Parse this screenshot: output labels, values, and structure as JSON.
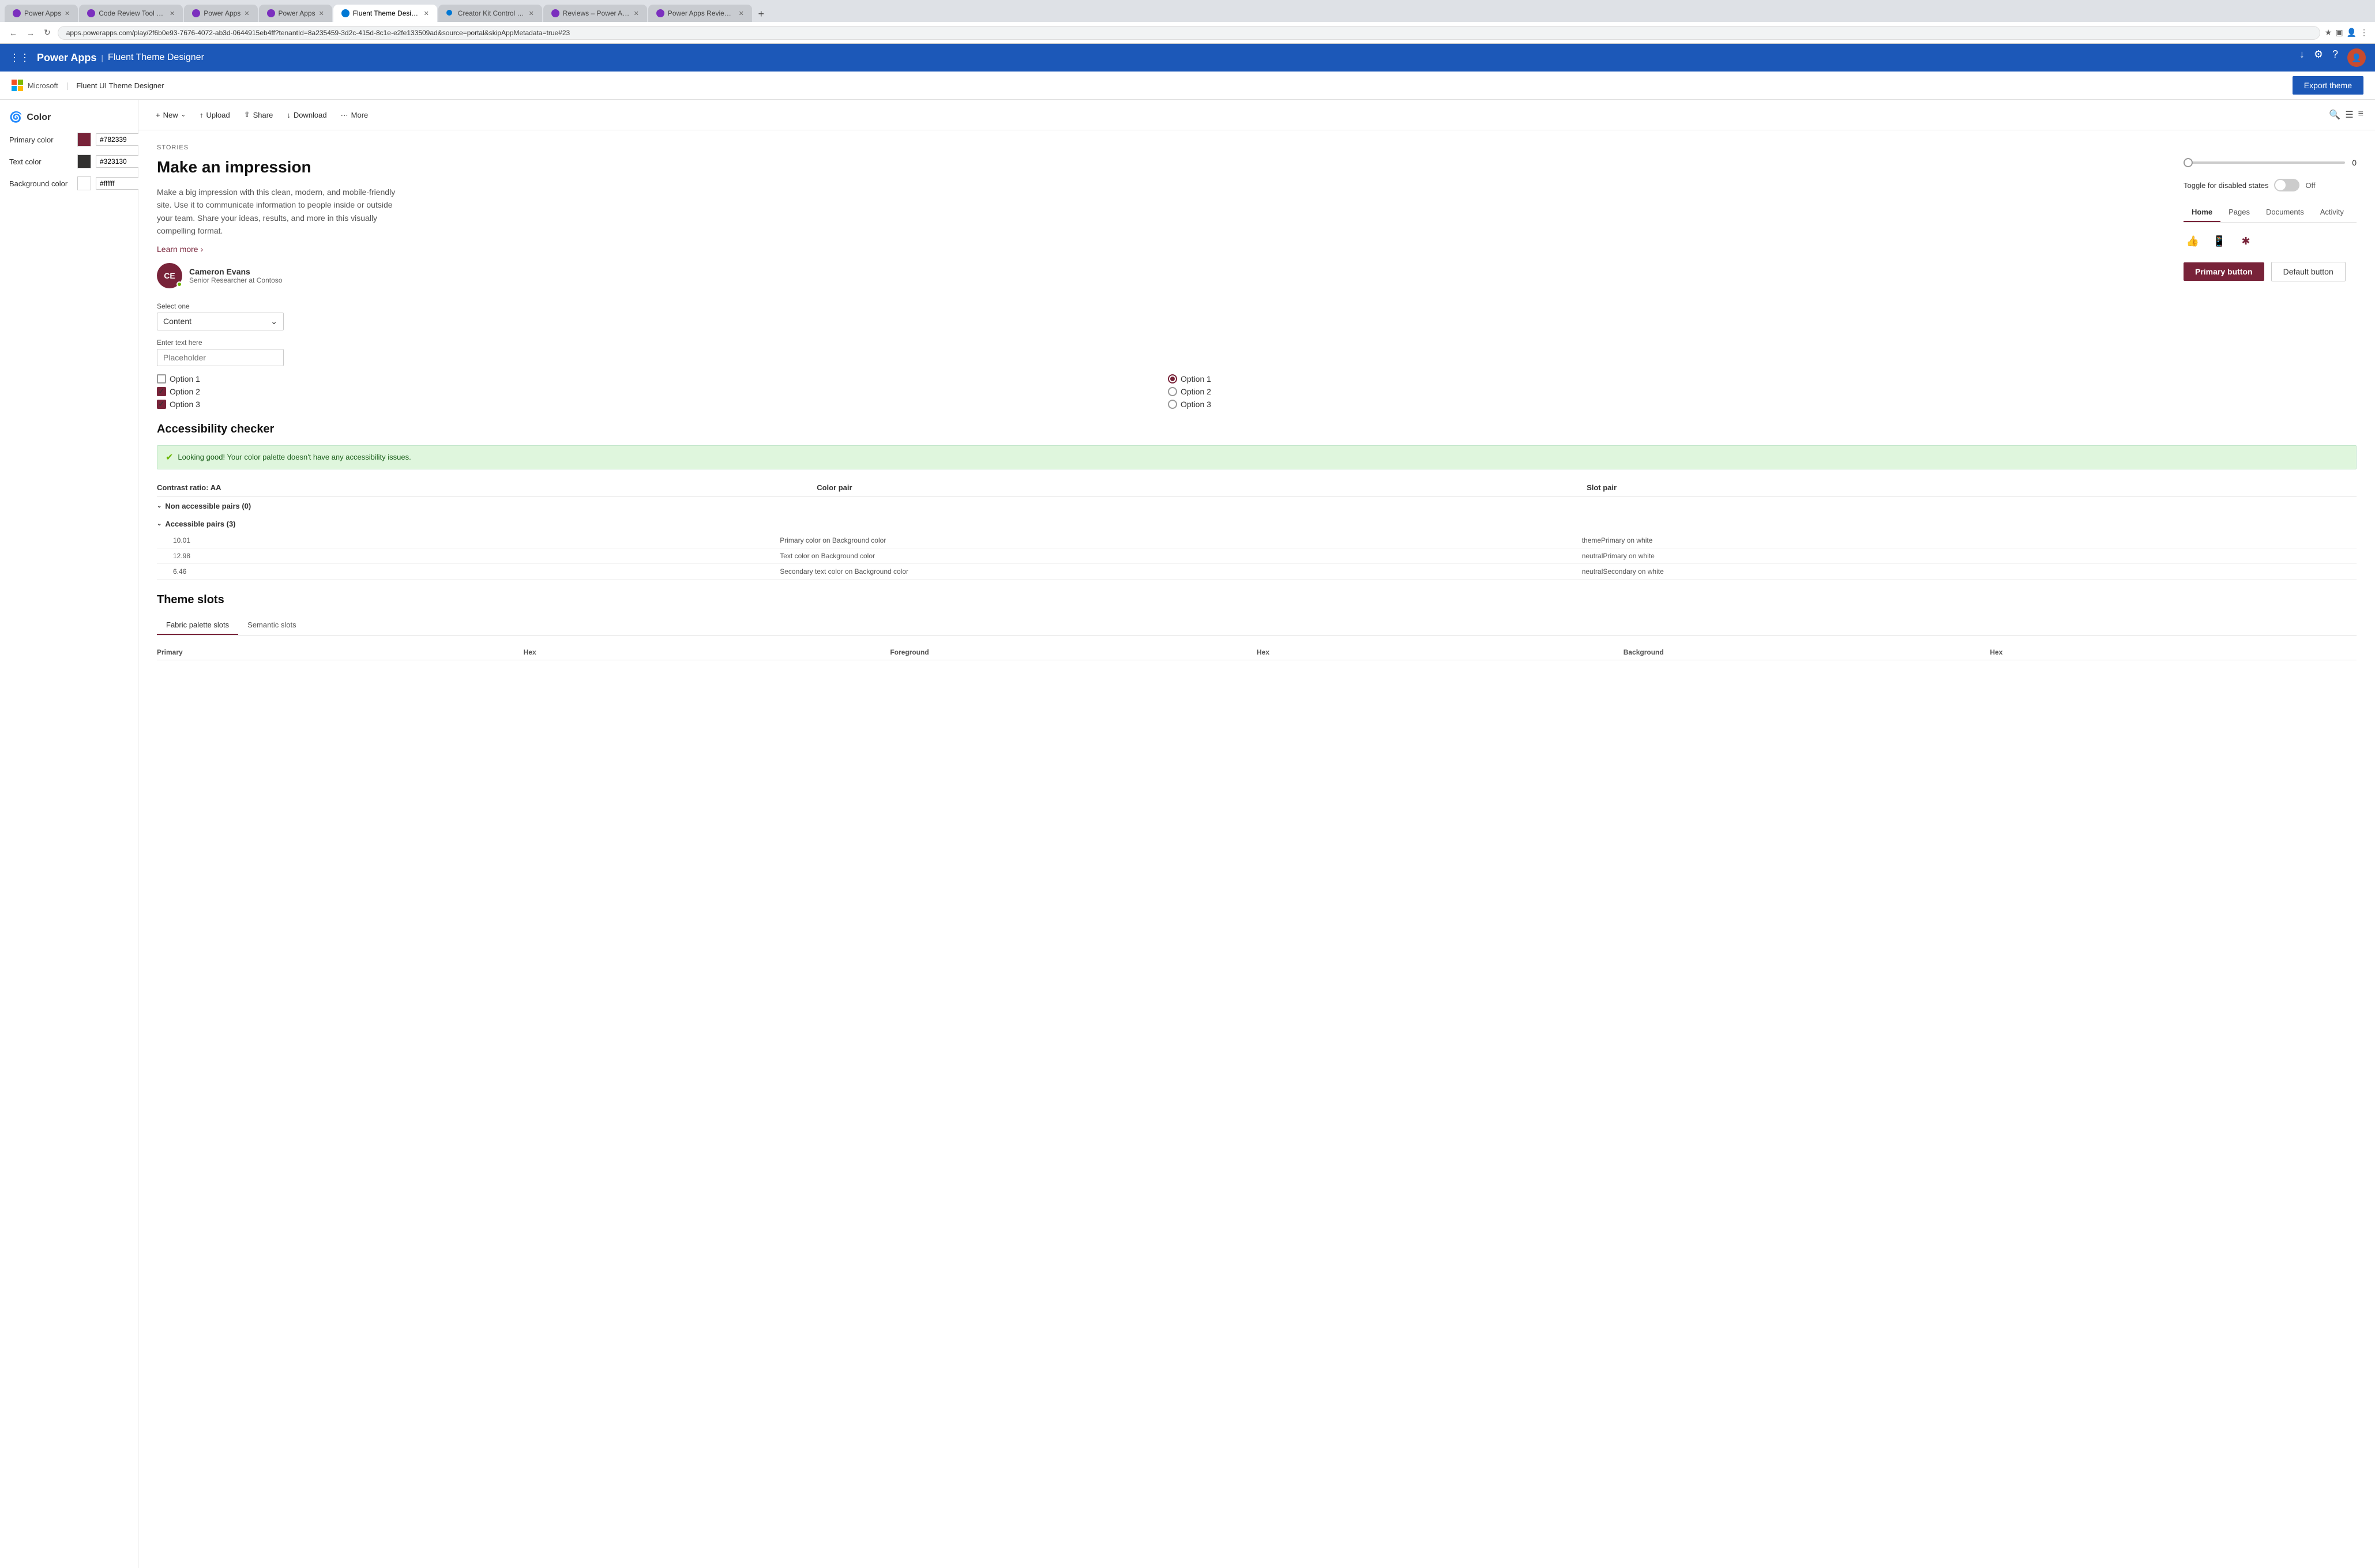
{
  "browser": {
    "tabs": [
      {
        "label": "Power Apps",
        "active": false,
        "favicon_color": "purple"
      },
      {
        "label": "Code Review Tool Experim...",
        "active": false,
        "favicon_color": "purple"
      },
      {
        "label": "Power Apps",
        "active": false,
        "favicon_color": "purple"
      },
      {
        "label": "Power Apps",
        "active": false,
        "favicon_color": "purple"
      },
      {
        "label": "Fluent Theme Designer -...",
        "active": true,
        "favicon_color": "blue"
      },
      {
        "label": "Creator Kit Control Refere...",
        "active": false,
        "favicon_color": "blue"
      },
      {
        "label": "Reviews – Power Apps",
        "active": false,
        "favicon_color": "purple"
      },
      {
        "label": "Power Apps Review Tool ...",
        "active": false,
        "favicon_color": "purple"
      }
    ],
    "url": "apps.powerapps.com/play/2f6b0e93-7676-4072-ab3d-0644915eb4ff?tenantId=8a235459-3d2c-415d-8c1e-e2fe133509ad&source=portal&skipAppMetadata=true#23"
  },
  "app_bar": {
    "brand": "Power Apps",
    "separator": "|",
    "section": "Fluent Theme Designer"
  },
  "sub_header": {
    "ms_label": "Microsoft",
    "tool_title": "Fluent UI Theme Designer",
    "export_btn": "Export theme"
  },
  "sidebar": {
    "section_title": "Color",
    "colors": [
      {
        "label": "Primary color",
        "value": "#782339",
        "input_val": "#782339"
      },
      {
        "label": "Text color",
        "value": "#323130",
        "input_val": "#323130"
      },
      {
        "label": "Background color",
        "value": "#ffffff",
        "input_val": "#ffffff"
      }
    ]
  },
  "toolbar": {
    "buttons": [
      {
        "label": "New",
        "icon": "+"
      },
      {
        "label": "Upload",
        "icon": "↑"
      },
      {
        "label": "Share",
        "icon": "⇧"
      },
      {
        "label": "Download",
        "icon": "↓"
      },
      {
        "label": "More",
        "icon": "..."
      }
    ]
  },
  "preview": {
    "stories_label": "STORIES",
    "headline": "Make an impression",
    "body_text": "Make a big impression with this clean, modern, and mobile-friendly site. Use it to communicate information to people inside or outside your team. Share your ideas, results, and more in this visually compelling format.",
    "learn_more": "Learn more",
    "avatar_initials": "CE",
    "avatar_name": "Cameron Evans",
    "avatar_title": "Senior Researcher at Contoso"
  },
  "form_controls": {
    "select_label": "Select one",
    "select_value": "Content",
    "text_label": "Enter text here",
    "text_placeholder": "Placeholder",
    "checkboxes": [
      {
        "label": "Option 1",
        "checked": false
      },
      {
        "label": "Option 1",
        "checked": false,
        "radio": true,
        "selected": true
      },
      {
        "label": "Option 2",
        "checked": true
      },
      {
        "label": "Option 2",
        "checked": false,
        "radio": true,
        "selected": false
      },
      {
        "label": "Option 3",
        "checked": true
      },
      {
        "label": "Option 3",
        "checked": false,
        "radio": true,
        "selected": false
      }
    ]
  },
  "right_panel": {
    "slider_value": "0",
    "toggle_label": "Off",
    "toggle_state": "disabled",
    "toggle_description": "Toggle for disabled states",
    "tabs": [
      {
        "label": "Home",
        "active": true
      },
      {
        "label": "Pages",
        "active": false
      },
      {
        "label": "Documents",
        "active": false
      },
      {
        "label": "Activity",
        "active": false
      }
    ],
    "primary_button": "Primary button",
    "default_button": "Default button"
  },
  "accessibility": {
    "section_title": "Accessibility checker",
    "good_message": "Looking good! Your color palette doesn't have any accessibility issues.",
    "table": {
      "headers": [
        "Contrast ratio: AA",
        "Color pair",
        "Slot pair"
      ],
      "non_accessible": {
        "label": "Non accessible pairs (0)",
        "items": []
      },
      "accessible": {
        "label": "Accessible pairs (3)",
        "items": [
          {
            "ratio": "10.01",
            "color_pair": "Primary color on Background color",
            "slot_pair": "themePrimary on white"
          },
          {
            "ratio": "12.98",
            "color_pair": "Text color on Background color",
            "slot_pair": "neutralPrimary on white"
          },
          {
            "ratio": "6.46",
            "color_pair": "Secondary text color on Background color",
            "slot_pair": "neutralSecondary on white"
          }
        ]
      }
    }
  },
  "theme_slots": {
    "section_title": "Theme slots",
    "tabs": [
      {
        "label": "Fabric palette slots",
        "active": true
      },
      {
        "label": "Semantic slots",
        "active": false
      }
    ],
    "table_headers": [
      "Primary",
      "Hex",
      "Foreground",
      "Hex",
      "Background",
      "Hex"
    ]
  }
}
